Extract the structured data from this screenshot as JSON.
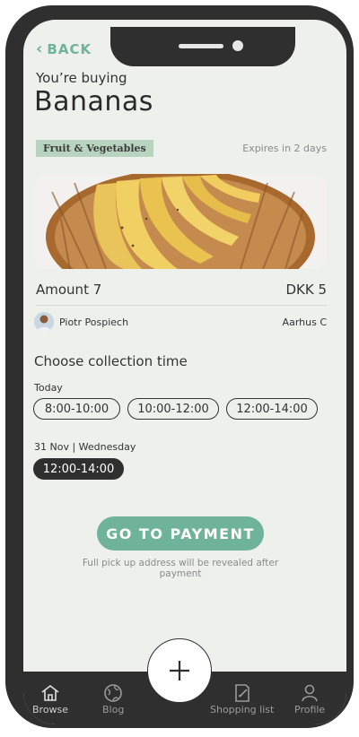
{
  "nav": {
    "back_label": "BACK"
  },
  "header": {
    "subtitle": "You’re buying",
    "title": "Bananas"
  },
  "product": {
    "category": "Fruit & Vegetables",
    "expires": "Expires in 2 days",
    "image_icon": "bananas-photo",
    "amount": "Amount 7",
    "price": "DKK 5"
  },
  "seller": {
    "name": "Piotr Pospiech",
    "location": "Aarhus C"
  },
  "collection": {
    "heading": "Choose collection time",
    "groups": [
      {
        "day": "Today",
        "slots": [
          {
            "label": "8:00-10:00",
            "selected": false
          },
          {
            "label": "10:00-12:00",
            "selected": false
          },
          {
            "label": "12:00-14:00",
            "selected": false
          }
        ]
      },
      {
        "day": "31 Nov | Wednesday",
        "slots": [
          {
            "label": "12:00-14:00",
            "selected": true
          }
        ]
      }
    ]
  },
  "payment": {
    "button_label": "GO TO PAYMENT",
    "note": "Full pick up address will be revealed after payment"
  },
  "tabbar": {
    "items": [
      {
        "label": "Browse",
        "icon": "home-icon"
      },
      {
        "label": "Blog",
        "icon": "globe-icon"
      },
      {
        "label": "Shopping list",
        "icon": "list-icon"
      },
      {
        "label": "Profile",
        "icon": "profile-icon"
      }
    ],
    "add_icon": "plus-icon"
  },
  "colors": {
    "accent": "#6fb39b",
    "dark": "#2f2f2f",
    "background": "#eef0ec",
    "tag": "#b8d3be"
  }
}
